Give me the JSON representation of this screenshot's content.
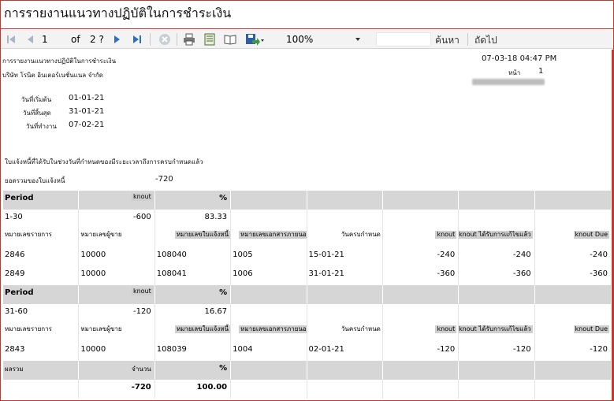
{
  "window": {
    "title": "การรายงานแนวทางปฏิบัติในการชำระเงิน"
  },
  "toolbar": {
    "page_current": "1",
    "of_label": "of",
    "page_total": "2 ?",
    "zoom_value": "100%",
    "find_label": "ค้นหา",
    "next_label": "ถัดไป"
  },
  "header": {
    "report_name": "การรายงานแนวทางปฏิบัติในการชำระเงิน",
    "company": "บริษัท โรนิต อินเตอร์เนชั่นแนล จำกัด",
    "datetime": "07-03-18 04:47 PM",
    "page_label": "หน้า",
    "page_number": "1",
    "date_start_label": "วันที่เริ่มต้น",
    "date_start": "01-01-21",
    "date_end_label": "วันที่สิ้นสุด",
    "date_end": "31-01-21",
    "date_work_label": "วันที่ทำงาน",
    "date_work": "07-02-21",
    "notice": "ใบแจ้งหนี้ที่ได้รับในช่วงวันที่กำหนดของมีระยะเวลาถึงการครบกำหนดแล้ว",
    "total_label": "ยอดรวมของใบแจ้งหนี้",
    "total_value": "-720"
  },
  "table": {
    "detail_headers": [
      "หมายเลขรายการ",
      "หมายเลขผู้ขาย",
      "หมายเลขใบแจ้งหนี้",
      "หมายเลขเอกสารภายนอก",
      "วันครบกำหนด",
      "knout",
      "knout ได้รับการแก้ไขแล้ว",
      "knout Due"
    ],
    "groups": [
      {
        "period_label": "Period",
        "amount_label": "knout",
        "percent_label": "%",
        "period": "1-30",
        "amount": "-600",
        "percent": "83.33",
        "rows": [
          [
            "2846",
            "10000",
            "108040",
            "1005",
            "15-01-21",
            "-240",
            "-240",
            "-240"
          ],
          [
            "2849",
            "10000",
            "108041",
            "1006",
            "31-01-21",
            "-360",
            "-360",
            "-360"
          ]
        ]
      },
      {
        "period_label": "Period",
        "amount_label": "knout",
        "percent_label": "%",
        "period": "31-60",
        "amount": "-120",
        "percent": "16.67",
        "rows": [
          [
            "2843",
            "10000",
            "108039",
            "1004",
            "02-01-21",
            "-120",
            "-120",
            "-120"
          ]
        ]
      }
    ],
    "summary": {
      "total_label": "ผลรวม",
      "amount_label": "จำนวน",
      "percent_label": "%",
      "amount": "-720",
      "percent": "100.00"
    }
  }
}
